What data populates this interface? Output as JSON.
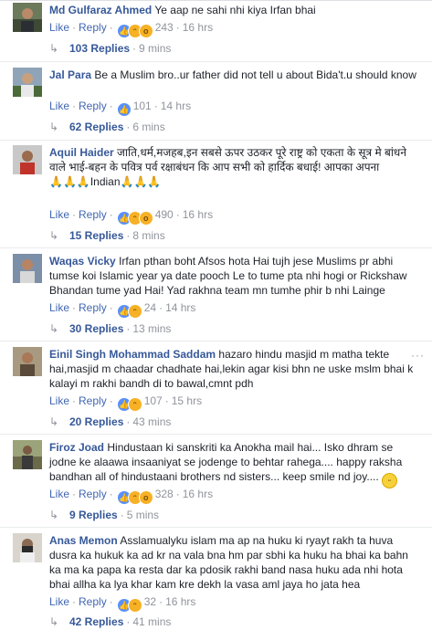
{
  "labels": {
    "like": "Like",
    "reply": "Reply"
  },
  "more_icon": "···",
  "comments": [
    {
      "name": "Md Gulfaraz Ahmed",
      "text": "Ye aap ne sahi nhi kiya Irfan bhai",
      "reactions": [
        "like",
        "haha",
        "wow"
      ],
      "count": "243",
      "time": "16 hrs",
      "replies": "103 Replies",
      "replies_time": "9 mins"
    },
    {
      "name": "Jal Para",
      "text": "Be a Muslim bro..ur father did not tell u about Bida't.u should know",
      "reactions": [
        "like"
      ],
      "count": "101",
      "time": "14 hrs",
      "replies": "62 Replies",
      "replies_time": "6 mins"
    },
    {
      "name": "Aquil Haider",
      "text": "जाति,धर्म,मजहब,इन सबसे ऊपर उठकर पूरे राष्ट्र को एकता के सूत्र मे बांधने वाले भाई-बहन के पवित्र पर्व रक्षाबंधन कि आप सभी को हार्दिक बधाई! आपका अपना",
      "text2": "Indian",
      "reactions": [
        "like",
        "haha",
        "wow"
      ],
      "count": "490",
      "time": "16 hrs",
      "replies": "15 Replies",
      "replies_time": "8 mins"
    },
    {
      "name": "Waqas Vicky",
      "text": "Irfan pthan boht Afsos hota Hai tujh jese Muslims pr abhi tumse koi Islamic year ya date pooch Le to tume pta nhi hogi or Rickshaw Bhandan tume yad Hai! Yad rakhna team mn tumhe phir b nhi Lainge",
      "reactions": [
        "like",
        "haha"
      ],
      "count": "24",
      "time": "14 hrs",
      "replies": "30 Replies",
      "replies_time": "13 mins"
    },
    {
      "name": "Einil Singh",
      "tag": "Mohammad Saddam",
      "text": "hazaro hindu masjid m matha tekte hai,masjid m chaadar chadhate hai,lekin agar kisi bhn ne uske mslm bhai k kalayi m rakhi bandh di to bawal,cmnt pdh",
      "reactions": [
        "like",
        "haha"
      ],
      "count": "107",
      "time": "15 hrs",
      "replies": "20 Replies",
      "replies_time": "43 mins"
    },
    {
      "name": "Firoz Joad",
      "text": "Hindustaan ki sanskriti ka Anokha mail hai... Isko dhram se jodne ke alaawa insaaniyat se jodenge to behtar rahega.... happy raksha bandhan all of hindustaani brothers nd sisters... keep smile nd joy....",
      "reactions": [
        "like",
        "haha",
        "wow"
      ],
      "count": "328",
      "time": "16 hrs",
      "replies": "9 Replies",
      "replies_time": "5 mins"
    },
    {
      "name": "Anas Memon",
      "text": "Asslamualyku islam ma ap na huku ki ryayt rakh ta huva dusra ka hukuk ka ad kr na vala bna hm par sbhi ka huku ha bhai ka bahn ka ma ka papa ka resta dar ka pdosik rakhi band nasa huku ada nhi hota bhai allha ka lya khar kam kre dekh la vasa aml jaya ho jata hea",
      "reactions": [
        "like",
        "haha"
      ],
      "count": "32",
      "time": "16 hrs",
      "replies": "42 Replies",
      "replies_time": "41 mins"
    }
  ]
}
